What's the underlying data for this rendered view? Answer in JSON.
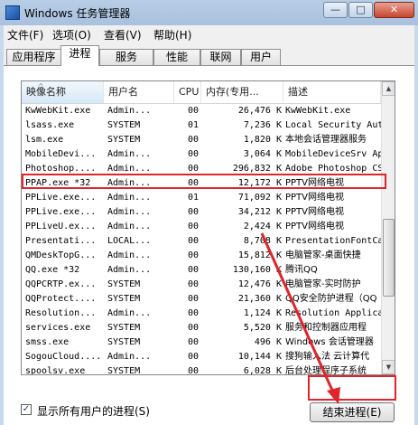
{
  "window": {
    "title": "Windows 任务管理器",
    "min_label": "—",
    "max_label": "□",
    "close_label": "✕"
  },
  "menu": [
    {
      "label": "文件(F)"
    },
    {
      "label": "选项(O)"
    },
    {
      "label": "查看(V)"
    },
    {
      "label": "帮助(H)"
    }
  ],
  "tabs": [
    {
      "label": "应用程序"
    },
    {
      "label": "进程",
      "active": true
    },
    {
      "label": "服务"
    },
    {
      "label": "性能"
    },
    {
      "label": "联网"
    },
    {
      "label": "用户"
    }
  ],
  "columns": {
    "name": "映像名称",
    "user": "用户名",
    "cpu": "CPU",
    "mem": "内存(专用...",
    "desc": "描述"
  },
  "processes": [
    {
      "name": "KwWebKit.exe",
      "user": "Admin...",
      "cpu": "00",
      "mem": "26,476 K",
      "desc": "KwWebKit.exe"
    },
    {
      "name": "lsass.exe",
      "user": "SYSTEM",
      "cpu": "01",
      "mem": "7,236 K",
      "desc": "Local Security Aut"
    },
    {
      "name": "lsm.exe",
      "user": "SYSTEM",
      "cpu": "00",
      "mem": "1,820 K",
      "desc": "本地会话管理器服务"
    },
    {
      "name": "MobileDevi...",
      "user": "Admin...",
      "cpu": "00",
      "mem": "3,064 K",
      "desc": "MobileDeviceSrv App"
    },
    {
      "name": "Photoshop....",
      "user": "Admin...",
      "cpu": "00",
      "mem": "296,832 K",
      "desc": "Adobe Photoshop CS"
    },
    {
      "name": "PPAP.exe *32",
      "user": "Admin...",
      "cpu": "00",
      "mem": "12,172 K",
      "desc": "PPTV网络电视"
    },
    {
      "name": "PPLive.exe...",
      "user": "Admin...",
      "cpu": "01",
      "mem": "71,092 K",
      "desc": "PPTV网络电视"
    },
    {
      "name": "PPLive.exe...",
      "user": "Admin...",
      "cpu": "00",
      "mem": "34,212 K",
      "desc": "PPTV网络电视"
    },
    {
      "name": "PPLiveU.ex...",
      "user": "Admin...",
      "cpu": "00",
      "mem": "2,424 K",
      "desc": "PPTV网络电视"
    },
    {
      "name": "Presentati...",
      "user": "LOCAL...",
      "cpu": "00",
      "mem": "8,708 K",
      "desc": "PresentationFontCa"
    },
    {
      "name": "QMDeskTopG...",
      "user": "Admin...",
      "cpu": "00",
      "mem": "15,812 K",
      "desc": "电脑管家-桌面快捷"
    },
    {
      "name": "QQ.exe *32",
      "user": "Admin...",
      "cpu": "00",
      "mem": "130,160 K",
      "desc": "腾讯QQ"
    },
    {
      "name": "QQPCRTP.ex...",
      "user": "SYSTEM",
      "cpu": "00",
      "mem": "12,476 K",
      "desc": "电脑管家-实时防护"
    },
    {
      "name": "QQProtect....",
      "user": "SYSTEM",
      "cpu": "00",
      "mem": "21,360 K",
      "desc": "QQ安全防护进程（QQ"
    },
    {
      "name": "Resolution...",
      "user": "Admin...",
      "cpu": "00",
      "mem": "1,124 K",
      "desc": "Resolution Applica"
    },
    {
      "name": "services.exe",
      "user": "SYSTEM",
      "cpu": "00",
      "mem": "5,520 K",
      "desc": "服务和控制器应用程"
    },
    {
      "name": "smss.exe",
      "user": "SYSTEM",
      "cpu": "00",
      "mem": "496 K",
      "desc": "Windows 会话管理器"
    },
    {
      "name": "SogouCloud....",
      "user": "Admin...",
      "cpu": "00",
      "mem": "10,144 K",
      "desc": "搜狗输入法 云计算代"
    },
    {
      "name": "spoolsv.exe",
      "user": "SYSTEM",
      "cpu": "00",
      "mem": "6,028 K",
      "desc": "后台处理程序子系统"
    }
  ],
  "show_all_users": {
    "label": "显示所有用户的进程(S)",
    "checked": true
  },
  "end_process_button": "结束进程(E)"
}
